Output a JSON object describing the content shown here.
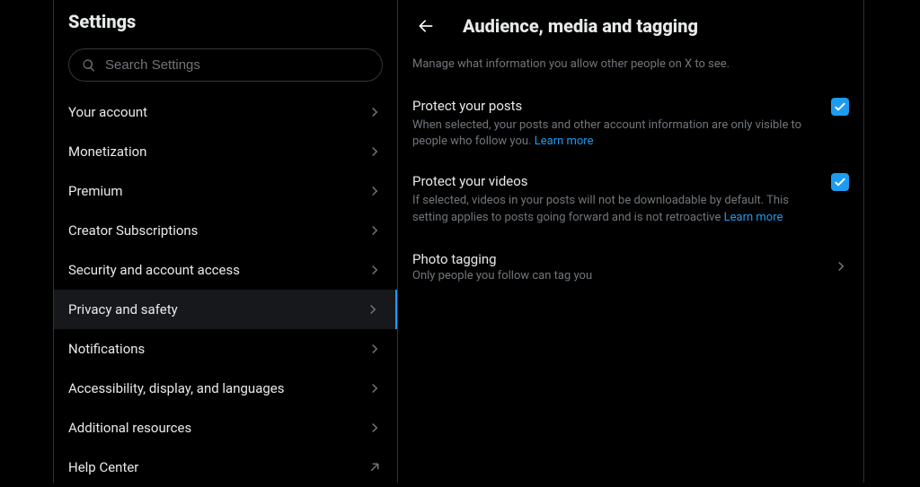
{
  "sidebar": {
    "title": "Settings",
    "search_placeholder": "Search Settings",
    "items": [
      {
        "label": "Your account",
        "type": "nav"
      },
      {
        "label": "Monetization",
        "type": "nav"
      },
      {
        "label": "Premium",
        "type": "nav"
      },
      {
        "label": "Creator Subscriptions",
        "type": "nav"
      },
      {
        "label": "Security and account access",
        "type": "nav"
      },
      {
        "label": "Privacy and safety",
        "type": "nav",
        "active": true
      },
      {
        "label": "Notifications",
        "type": "nav"
      },
      {
        "label": "Accessibility, display, and languages",
        "type": "nav"
      },
      {
        "label": "Additional resources",
        "type": "nav"
      },
      {
        "label": "Help Center",
        "type": "external"
      }
    ]
  },
  "main": {
    "title": "Audience, media and tagging",
    "subtitle": "Manage what information you allow other people on X to see.",
    "protect_posts": {
      "title": "Protect your posts",
      "desc": "When selected, your posts and other account information are only visible to people who follow you. ",
      "learn": "Learn more",
      "checked": true
    },
    "protect_videos": {
      "title": "Protect your videos",
      "desc": "If selected, videos in your posts will not be downloadable by default. This setting applies to posts going forward and is not retroactive ",
      "learn": "Learn more",
      "checked": true
    },
    "photo_tagging": {
      "title": "Photo tagging",
      "subtitle": "Only people you follow can tag you"
    }
  }
}
